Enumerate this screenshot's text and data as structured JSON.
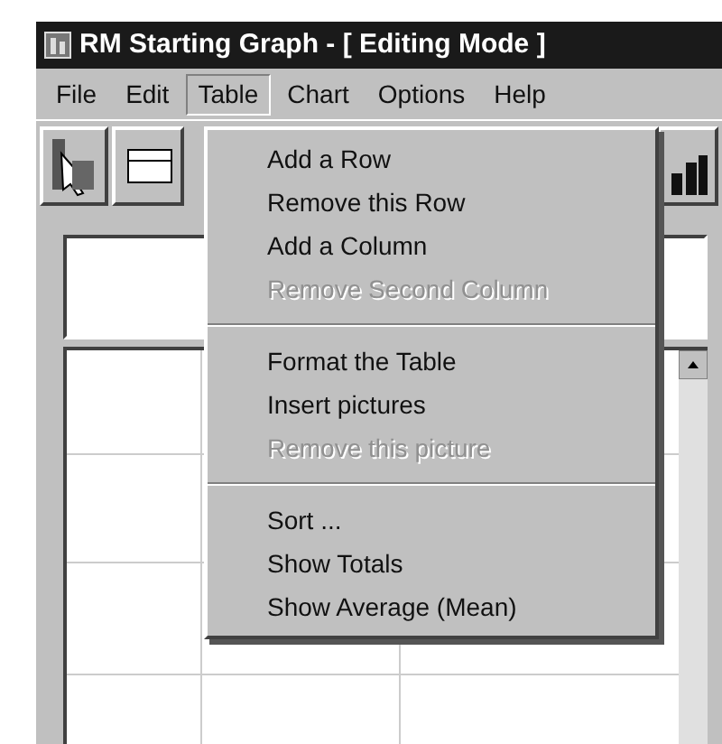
{
  "window": {
    "title": "RM Starting Graph - [ Editing Mode ]"
  },
  "menu_bar": [
    {
      "label": "File",
      "selected": false
    },
    {
      "label": "Edit",
      "selected": false
    },
    {
      "label": "Table",
      "selected": true
    },
    {
      "label": "Chart",
      "selected": false
    },
    {
      "label": "Options",
      "selected": false
    },
    {
      "label": "Help",
      "selected": false
    }
  ],
  "table_menu": [
    {
      "kind": "item",
      "label": "Add a Row",
      "disabled": false
    },
    {
      "kind": "item",
      "label": "Remove this Row",
      "disabled": false
    },
    {
      "kind": "item",
      "label": "Add a Column",
      "disabled": false
    },
    {
      "kind": "item",
      "label": "Remove Second Column",
      "disabled": true
    },
    {
      "kind": "separator"
    },
    {
      "kind": "item",
      "label": "Format the Table",
      "disabled": false
    },
    {
      "kind": "item",
      "label": "Insert pictures",
      "disabled": false
    },
    {
      "kind": "item",
      "label": "Remove this picture",
      "disabled": true
    },
    {
      "kind": "separator"
    },
    {
      "kind": "item",
      "label": "Sort ...",
      "disabled": false
    },
    {
      "kind": "item",
      "label": "Show Totals",
      "disabled": false
    },
    {
      "kind": "item",
      "label": "Show Average (Mean)",
      "disabled": false
    }
  ]
}
